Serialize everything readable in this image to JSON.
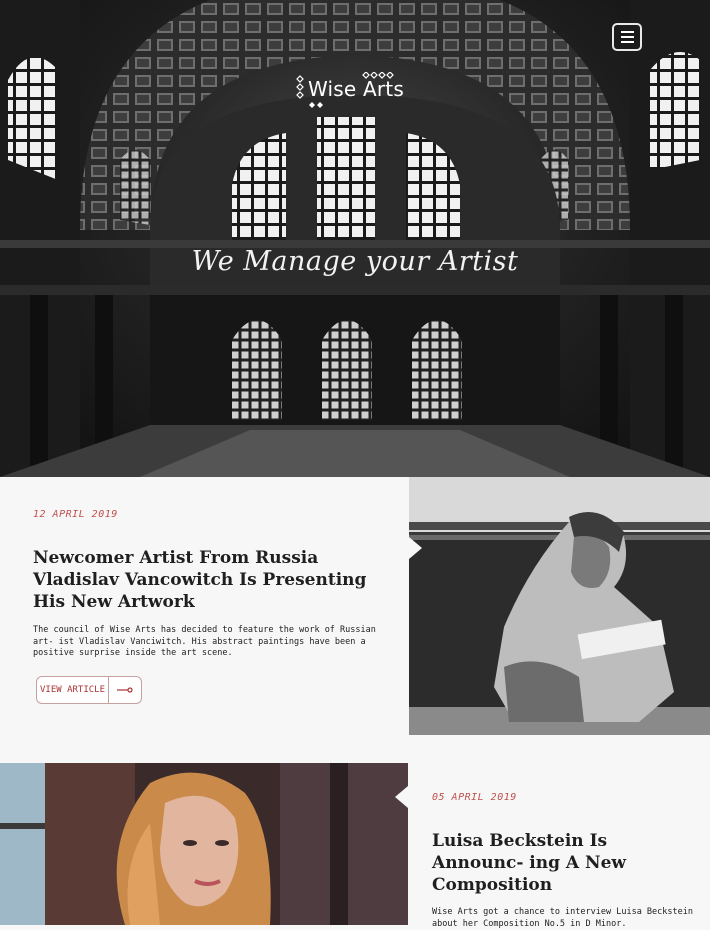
{
  "brand": {
    "name": "Wise Arts"
  },
  "hero": {
    "tagline": "We Manage your Artist"
  },
  "articles": [
    {
      "date": "12 APRIL 2019",
      "title": "Newcomer Artist From Russia Vladislav Vancowitch Is Presenting His New Artwork",
      "excerpt": "The council of Wise Arts has decided to feature the work of Russian art- ist Vladislav Vanciwitch. His abstract paintings have been a positive surprise inside the art scene.",
      "button_label": "VIEW ARTICLE",
      "button_icon": "arrow-right-icon"
    },
    {
      "date": "05 APRIL 2019",
      "title": "Luisa Beckstein Is Announc- ing A New Composition",
      "excerpt": "Wise Arts got a chance to interview Luisa Beckstein about her Composition No.5 in D Minor."
    }
  ],
  "colors": {
    "accent": "#c0504d",
    "heading": "#1f1f1f",
    "background": "#f7f7f7"
  }
}
